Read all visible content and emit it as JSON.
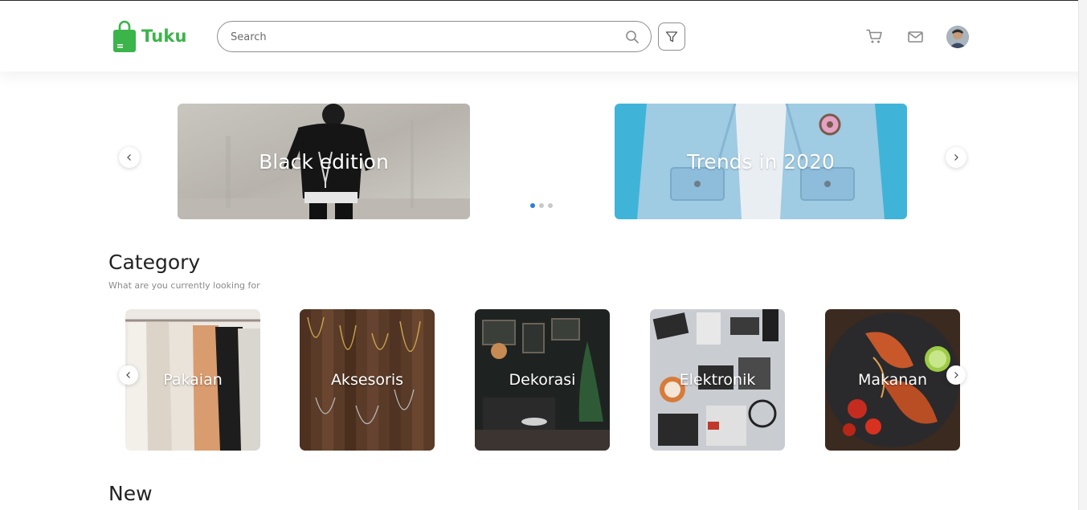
{
  "brand": {
    "name": "Tuku",
    "color": "#3bb44a"
  },
  "search": {
    "placeholder": "Search"
  },
  "header_icons": [
    "search-icon",
    "filter-icon",
    "cart-icon",
    "mail-icon",
    "avatar"
  ],
  "carousel": {
    "slides": [
      {
        "title": "Black edition"
      },
      {
        "title": "Trends in 2020"
      }
    ],
    "dots": 3,
    "active_dot": 1
  },
  "category": {
    "title": "Category",
    "subtitle": "What are you currently looking for",
    "items": [
      {
        "label": "Pakaian"
      },
      {
        "label": "Aksesoris"
      },
      {
        "label": "Dekorasi"
      },
      {
        "label": "Elektronik"
      },
      {
        "label": "Makanan"
      }
    ]
  },
  "new_section": {
    "title": "New"
  },
  "colors": {
    "accent": "#3bb44a",
    "dot_active": "#2b7fd6"
  }
}
